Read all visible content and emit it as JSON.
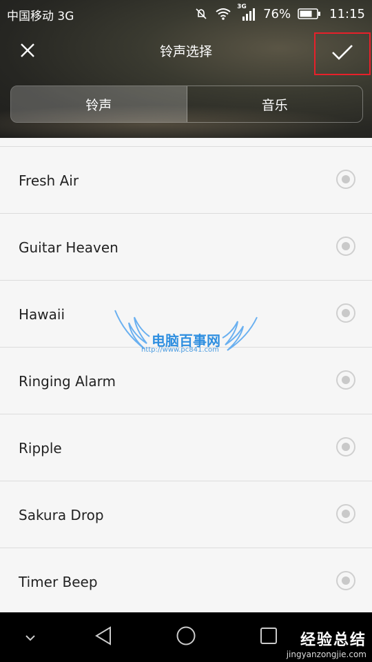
{
  "status_bar": {
    "carrier": "中国移动 3G",
    "network_label": "3G",
    "battery_percent": "76%",
    "time": "11:15"
  },
  "title_bar": {
    "title": "铃声选择",
    "close_icon": "close-icon",
    "confirm_icon": "check-icon"
  },
  "tabs": [
    {
      "label": "铃声",
      "active": true
    },
    {
      "label": "音乐",
      "active": false
    }
  ],
  "ringtones": [
    {
      "name": "Fresh Air",
      "selected": false
    },
    {
      "name": "Guitar Heaven",
      "selected": false
    },
    {
      "name": "Hawaii",
      "selected": false
    },
    {
      "name": "Ringing Alarm",
      "selected": false
    },
    {
      "name": "Ripple",
      "selected": false
    },
    {
      "name": "Sakura Drop",
      "selected": false
    },
    {
      "name": "Timer Beep",
      "selected": false
    }
  ],
  "watermark": {
    "title": "电脑百事网",
    "url": "http://www.pc841.com"
  },
  "site_watermark": {
    "name": "经验总结",
    "url": "jingyanzongjie.com"
  },
  "colors": {
    "highlight_border": "#e8202a",
    "radio": "#c9c9c9"
  }
}
